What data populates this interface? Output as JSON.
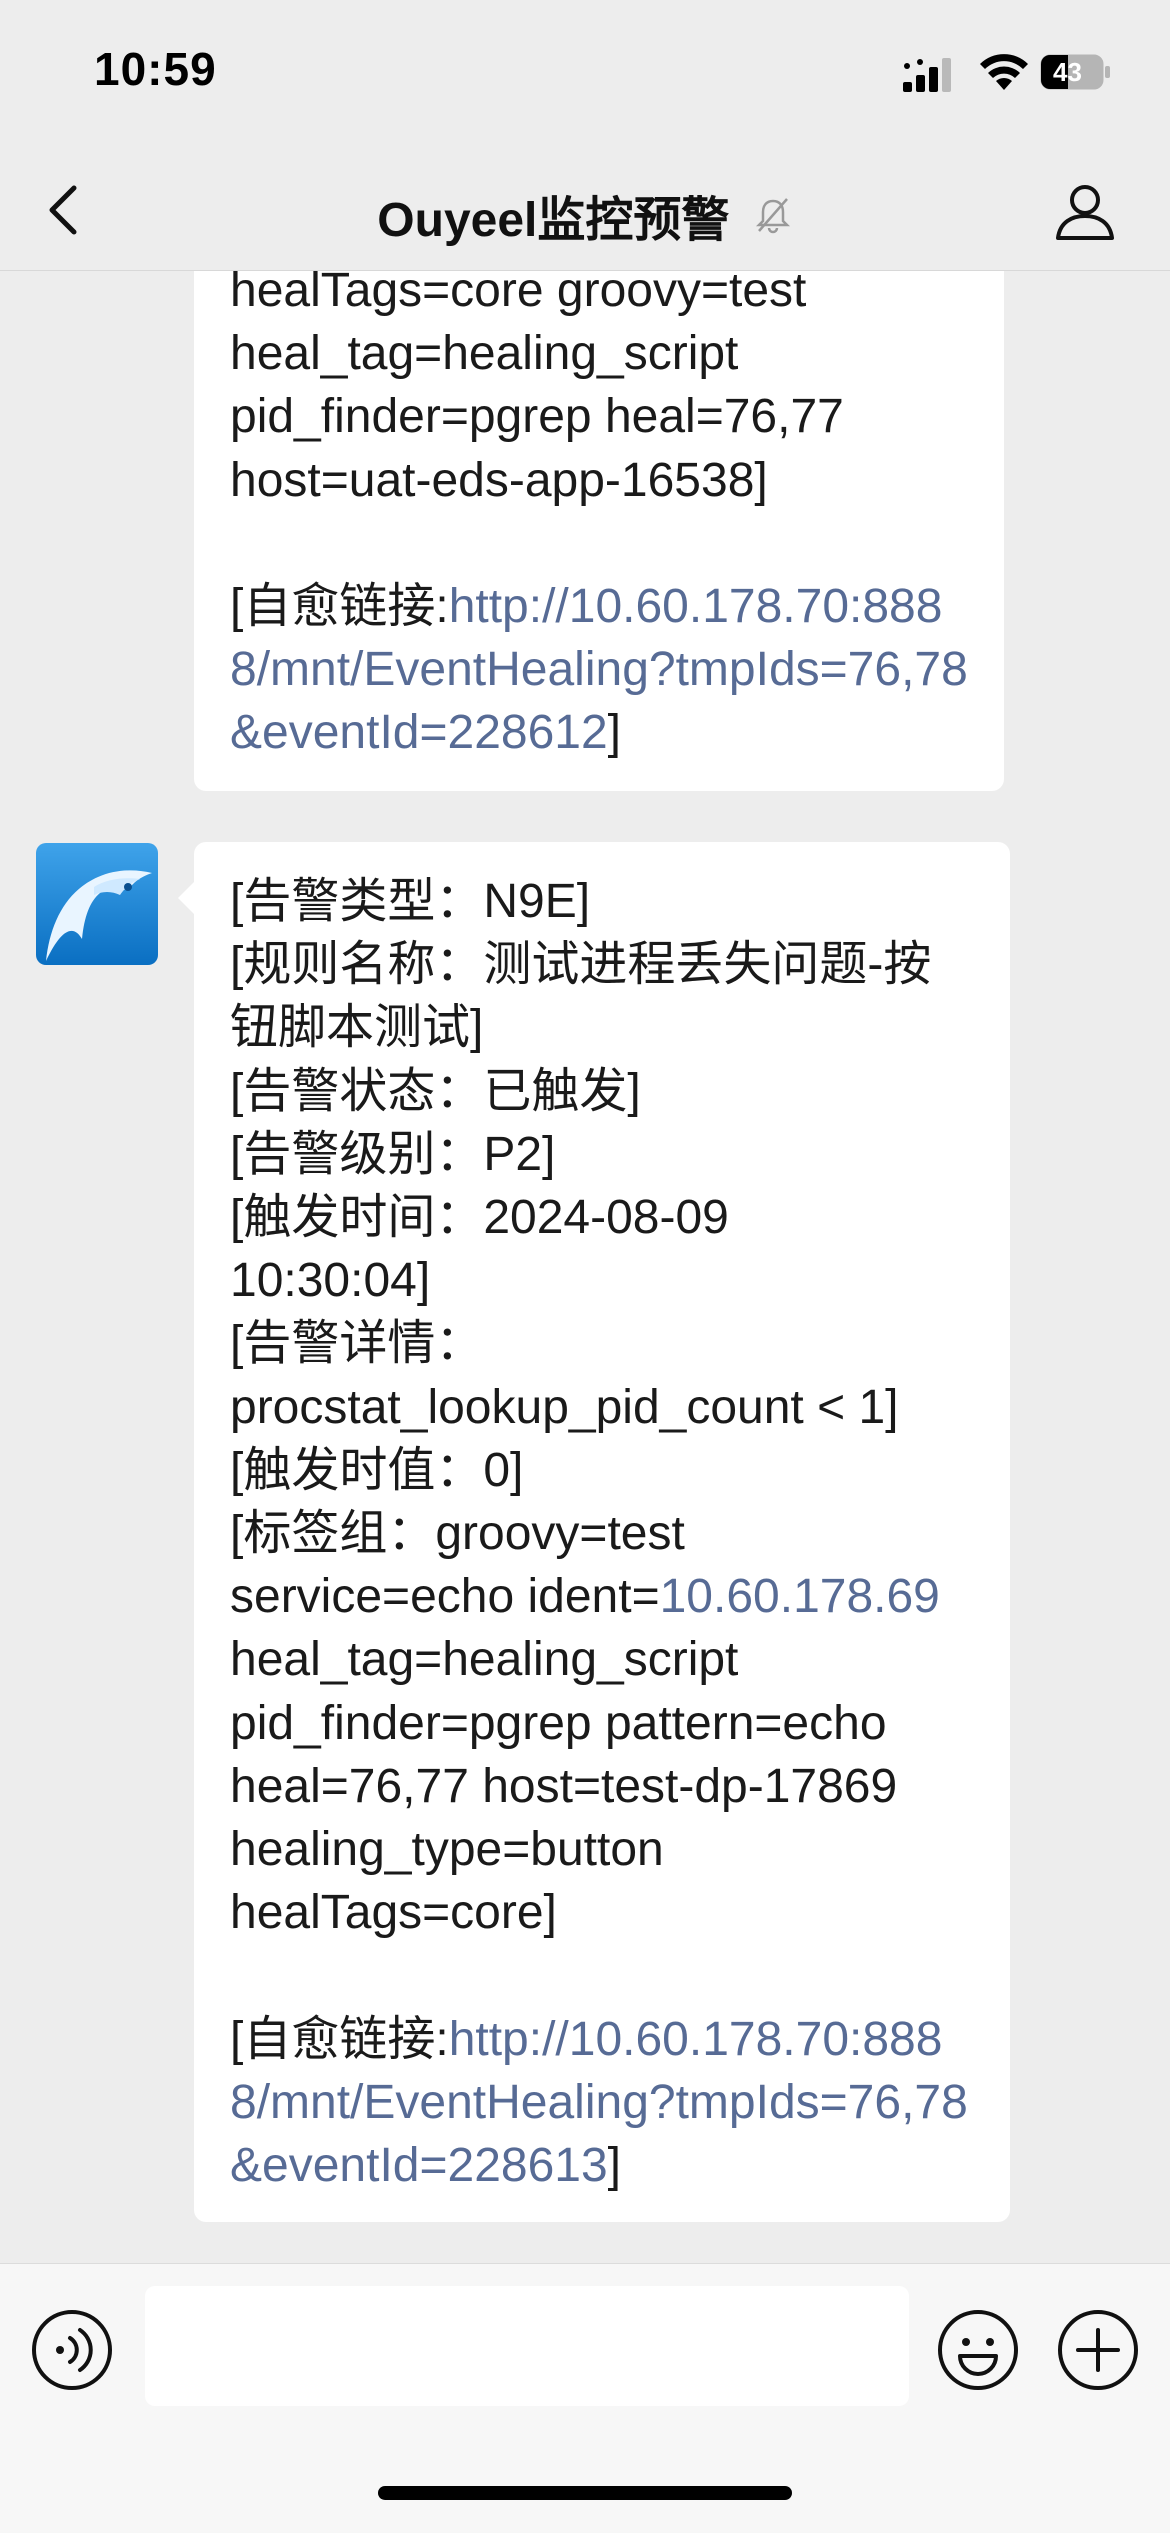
{
  "status": {
    "time": "10:59",
    "battery": "43"
  },
  "header": {
    "title": "Ouyeel监控预警"
  },
  "messages": [
    {
      "text_before_link": "healTags=core groovy=test\nheal_tag=healing_script\npid_finder=pgrep heal=76,77\nhost=uat-eds-app-16538]\n\n[自愈链接:",
      "link": "http://10.60.178.70:8888/mnt/EventHealing?tmpIds=76,78&eventId=228612",
      "text_after_link": "]"
    },
    {
      "text_before_ip": "[告警类型：N9E]\n[规则名称：测试进程丢失问题-按钮脚本测试]\n[告警状态：已触发]\n[告警级别：P2]\n[触发时间：2024-08-09\n10:30:04]\n[告警详情：\nprocstat_lookup_pid_count < 1]\n[触发时值：0]\n[标签组：groovy=test\nservice=echo ident=",
      "ip_link": "10.60.178.69",
      "text_after_ip": " heal_tag=healing_script\npid_finder=pgrep pattern=echo\nheal=76,77 host=test-dp-17869\nhealing_type=button\nhealTags=core]\n\n[自愈链接:",
      "link": "http://10.60.178.70:8888/mnt/EventHealing?tmpIds=76,78&eventId=228613",
      "text_after_link": "]"
    }
  ],
  "input": {
    "value": ""
  }
}
